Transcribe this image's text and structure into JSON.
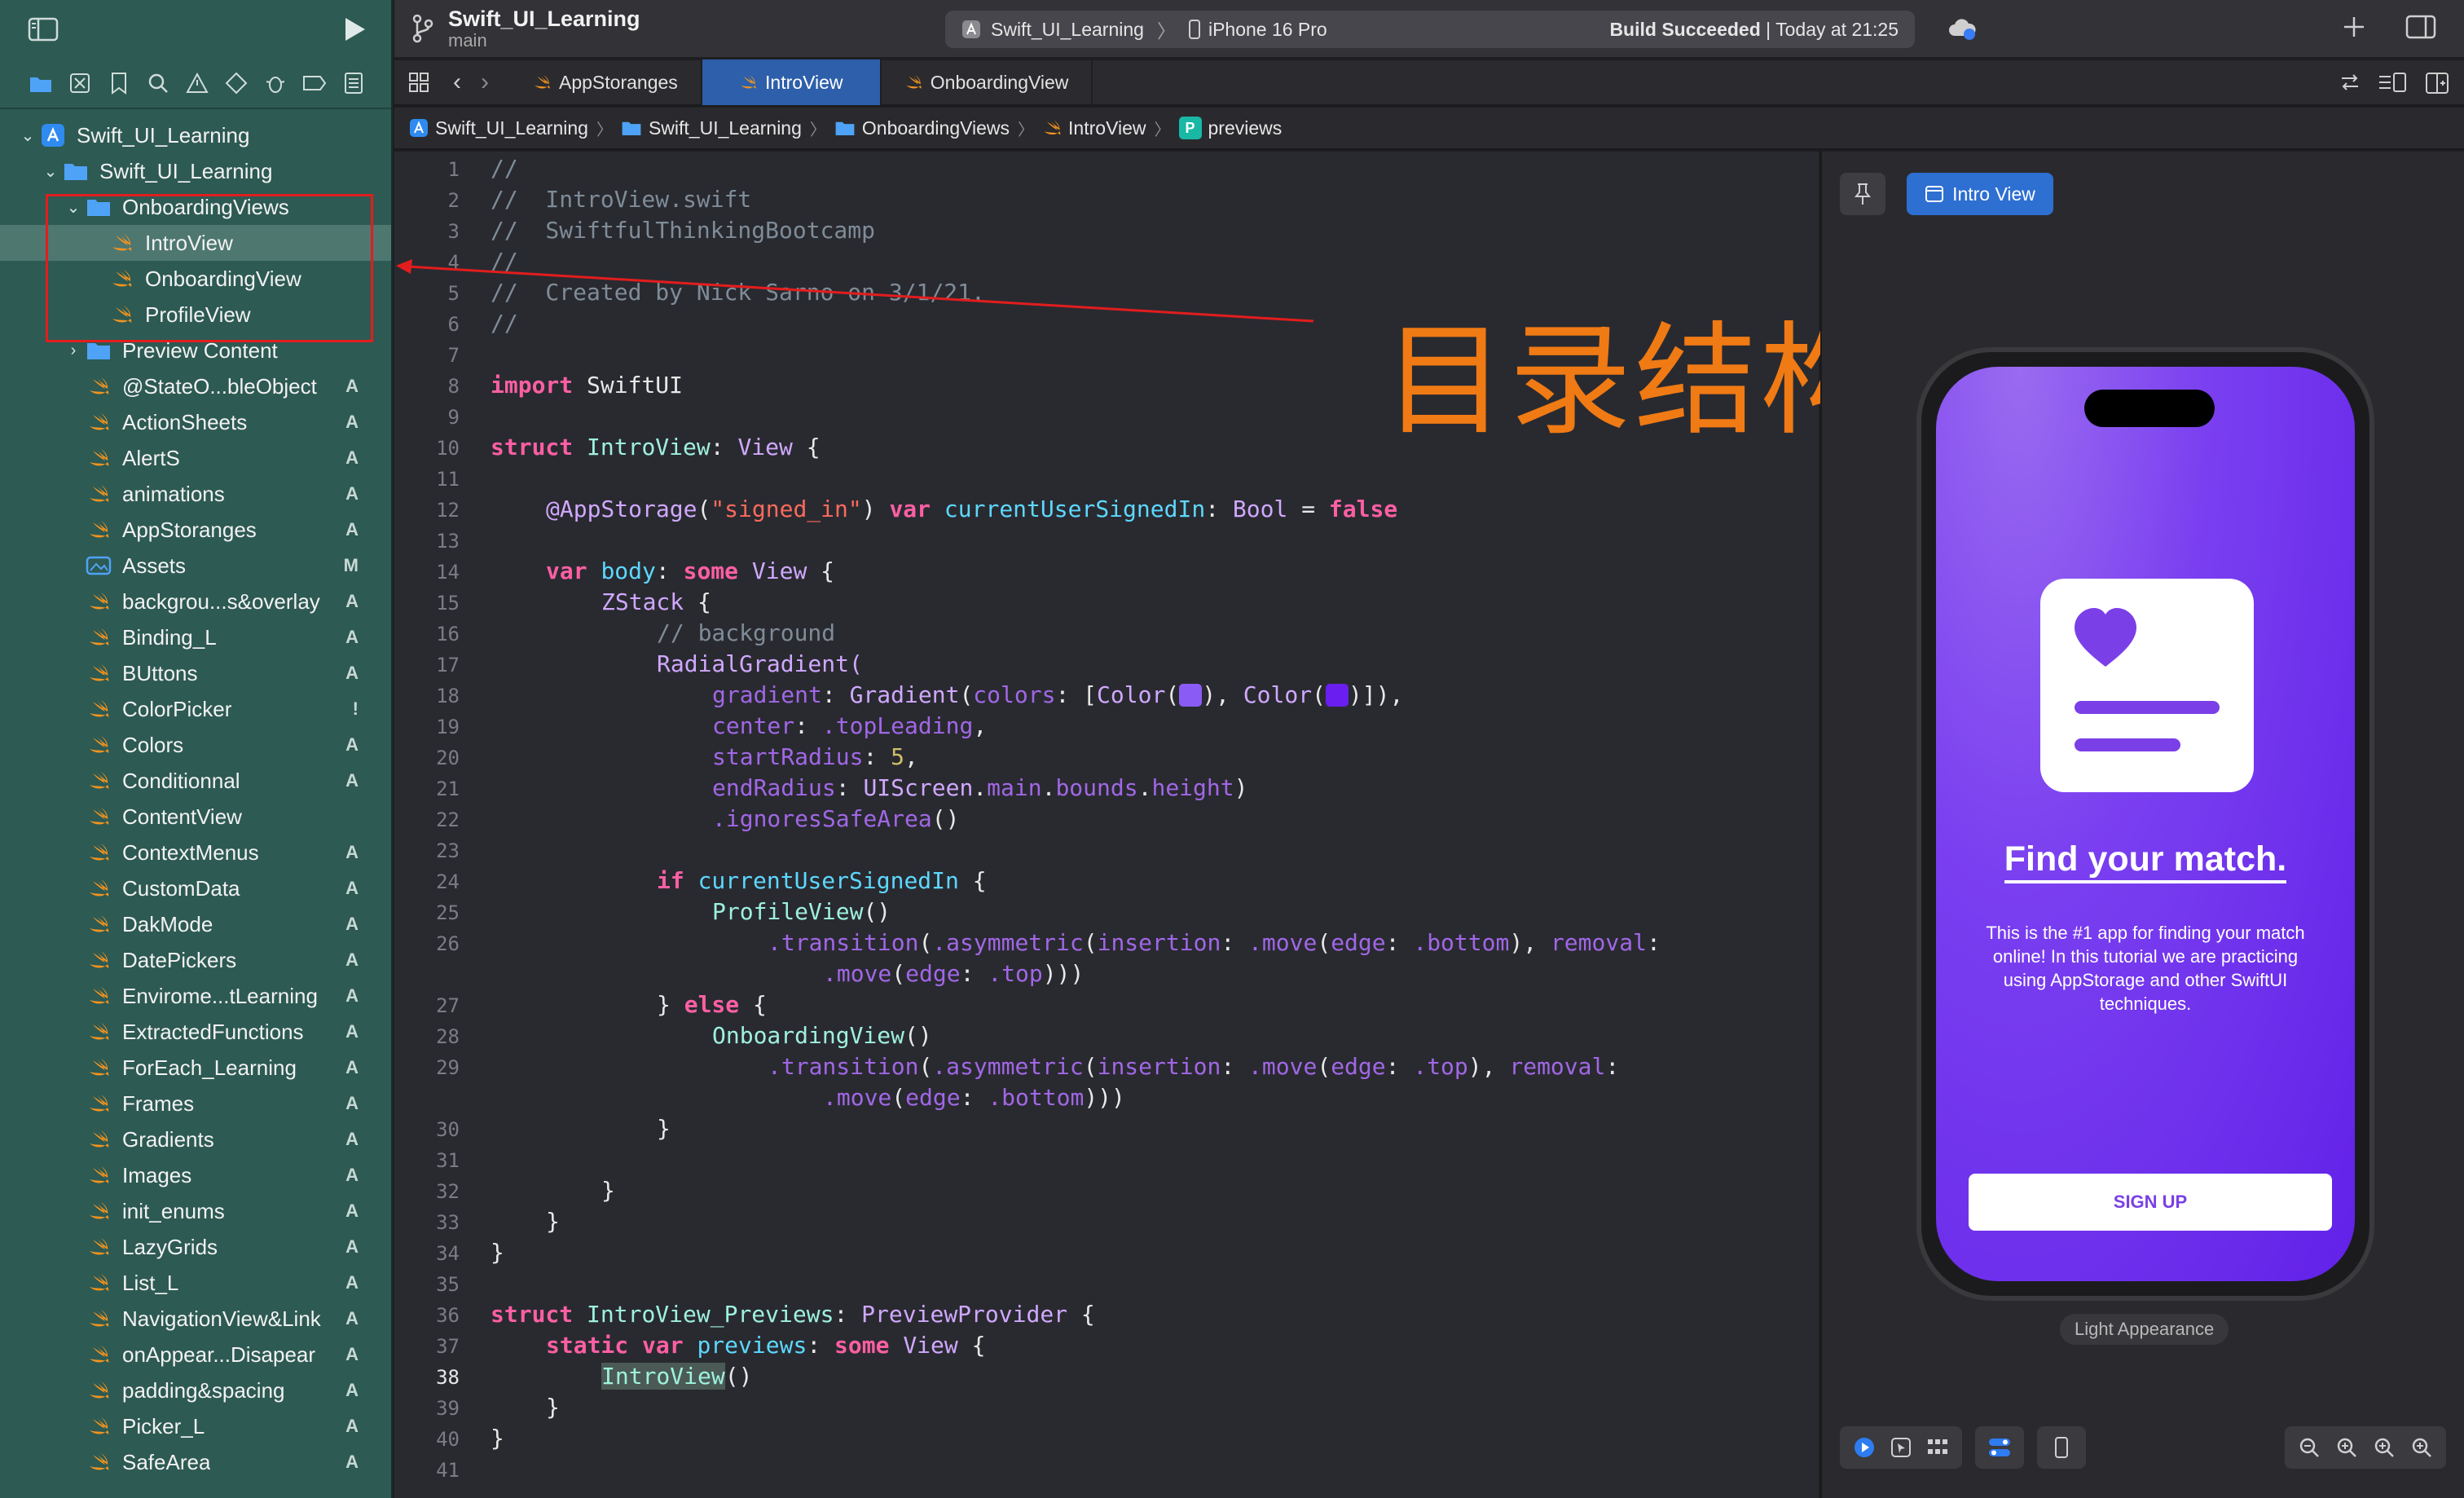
{
  "project": {
    "name": "Swift_UI_Learning",
    "branch": "main"
  },
  "scheme": {
    "target": "Swift_UI_Learning",
    "device": "iPhone 16 Pro",
    "status_bold": "Build Succeeded",
    "status_time": "| Today at 21:25"
  },
  "tabs": [
    {
      "label": "AppStoranges"
    },
    {
      "label": "IntroView"
    },
    {
      "label": "OnboardingView"
    }
  ],
  "breadcrumb": [
    "Swift_UI_Learning",
    "Swift_UI_Learning",
    "OnboardingViews",
    "IntroView",
    "previews"
  ],
  "sidebar": {
    "root": "Swift_UI_Learning",
    "group": "Swift_UI_Learning",
    "folder": "OnboardingViews",
    "folder_items": [
      "IntroView",
      "OnboardingView",
      "ProfileView"
    ],
    "preview_content": "Preview Content",
    "files": [
      {
        "name": "@StateO...bleObject",
        "badge": "A"
      },
      {
        "name": "ActionSheets",
        "badge": "A"
      },
      {
        "name": "AlertS",
        "badge": "A"
      },
      {
        "name": "animations",
        "badge": "A"
      },
      {
        "name": "AppStoranges",
        "badge": "A"
      },
      {
        "name": "Assets",
        "badge": "M"
      },
      {
        "name": "backgrou...s&overlay",
        "badge": "A"
      },
      {
        "name": "Binding_L",
        "badge": "A"
      },
      {
        "name": "BUttons",
        "badge": "A"
      },
      {
        "name": "ColorPicker",
        "badge": "!"
      },
      {
        "name": "Colors",
        "badge": "A"
      },
      {
        "name": "Conditionnal",
        "badge": "A"
      },
      {
        "name": "ContentView",
        "badge": ""
      },
      {
        "name": "ContextMenus",
        "badge": "A"
      },
      {
        "name": "CustomData",
        "badge": "A"
      },
      {
        "name": "DakMode",
        "badge": "A"
      },
      {
        "name": "DatePickers",
        "badge": "A"
      },
      {
        "name": "Envirome...tLearning",
        "badge": "A"
      },
      {
        "name": "ExtractedFunctions",
        "badge": "A"
      },
      {
        "name": "ForEach_Learning",
        "badge": "A"
      },
      {
        "name": "Frames",
        "badge": "A"
      },
      {
        "name": "Gradients",
        "badge": "A"
      },
      {
        "name": "Images",
        "badge": "A"
      },
      {
        "name": "init_enums",
        "badge": "A"
      },
      {
        "name": "LazyGrids",
        "badge": "A"
      },
      {
        "name": "List_L",
        "badge": "A"
      },
      {
        "name": "NavigationView&Link",
        "badge": "A"
      },
      {
        "name": "onAppear...Disapear",
        "badge": "A"
      },
      {
        "name": "padding&spacing",
        "badge": "A"
      },
      {
        "name": "Picker_L",
        "badge": "A"
      },
      {
        "name": "SafeArea",
        "badge": "A"
      }
    ]
  },
  "code": {
    "line_numbers": [
      "1",
      "2",
      "3",
      "4",
      "5",
      "6",
      "7",
      "8",
      "9",
      "10",
      "11",
      "12",
      "13",
      "14",
      "15",
      "16",
      "17",
      "18",
      "19",
      "20",
      "21",
      "22",
      "23",
      "24",
      "25",
      "26",
      "27",
      "28",
      "29",
      "30",
      "31",
      "32",
      "33",
      "34",
      "35",
      "36",
      "37",
      "38",
      "39",
      "40",
      "41"
    ],
    "t": {
      "l1": "//",
      "l2": "//  IntroView.swift",
      "l3": "//  SwiftfulThinkingBootcamp",
      "l4": "//",
      "l5": "//  Created by Nick Sarno on 3/1/21.",
      "l6": "//",
      "import": "import",
      "swiftui": " SwiftUI",
      "struct": "struct",
      "introview": "IntroView",
      "colon": ":",
      "view": "View",
      "brace_open": " {",
      "appstorage": "@AppStorage",
      "paren_open": "(",
      "signed_in_str": "\"signed_in\"",
      "paren_close": ")",
      "var": "var",
      "currentUserSignedIn": "currentUserSignedIn",
      "bool": "Bool",
      "eq": " = ",
      "false": "false",
      "body": "body",
      "some": "some",
      "zstack": "ZStack",
      "bg_comment": "// background",
      "radial": "RadialGradient(",
      "gradient": "gradient",
      "gradient_type": "Gradient",
      "colors": "colors",
      "color_fn": "Color",
      "l18_mid": "), ",
      "l18_end": ")]),",
      "center": "center",
      "topLeading": ".topLeading",
      "startRadius": "startRadius",
      "five": "5",
      "endRadius": "endRadius",
      "uiscreen": "UIScreen",
      "dot": ".",
      "main": "main",
      "bounds": "bounds",
      "height": "height",
      "ignores": ".ignoresSafeArea",
      "call": "()",
      "if": "if",
      "profileview": "ProfileView",
      "transition": ".transition",
      "asymmetric": ".asymmetric",
      "insertion": "insertion",
      "move": ".move",
      "edge": "edge",
      "bottom": ".bottom",
      "top": ".top",
      "removal": "removal",
      "close3": ")))",
      "close_rem": "), ",
      "else": "else",
      "close_brace": "}",
      "close_brace_else": "} ",
      "onboardingview": "OnboardingView",
      "previews_struct": "IntroView_Previews",
      "previewprovider": "PreviewProvider",
      "static": "static",
      "previews": "previews",
      "comma": ",",
      "space": " "
    }
  },
  "preview": {
    "chip": "Intro View",
    "headline": "Find your match.",
    "description": "This is the #1 app for finding your match online! In this tutorial we are practicing using AppStorage and other SwiftUI techniques.",
    "button": "SIGN UP",
    "appearance": "Light Appearance"
  },
  "annotation": "目录结构",
  "colors": {
    "gradient_a": "#8a5cf5",
    "gradient_b": "#6a1ef0",
    "annotation": "#f07a14",
    "highlight": "#e21d1d"
  }
}
